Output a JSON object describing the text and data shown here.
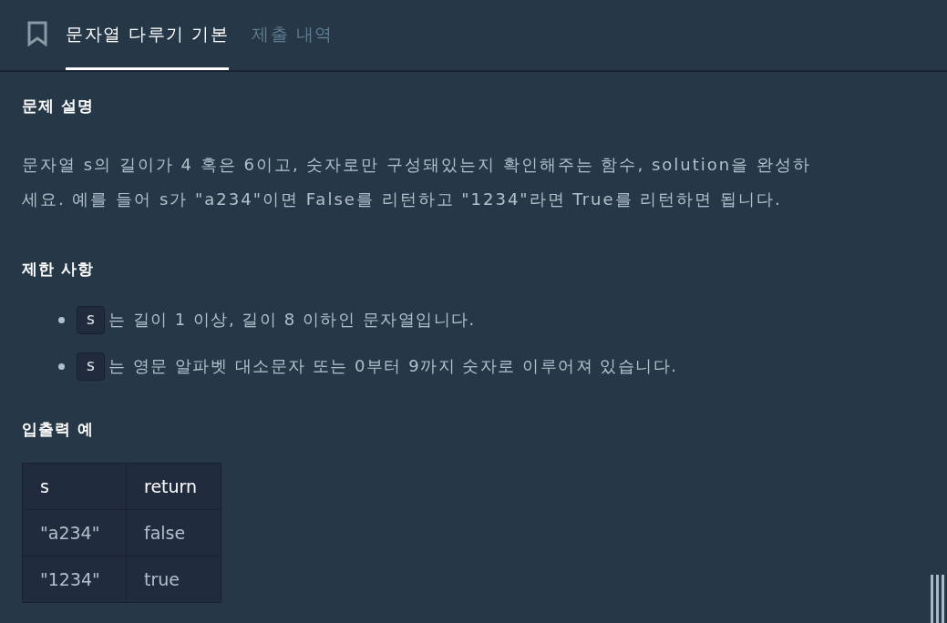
{
  "tabs": [
    {
      "label": "문자열 다루기 기본",
      "selected": true
    },
    {
      "label": "제출 내역",
      "selected": false
    }
  ],
  "description": {
    "title": "문제 설명",
    "text": "문자열 s의 길이가 4 혹은 6이고, 숫자로만 구성돼있는지 확인해주는 함수, solution을 완성하세요. 예를 들어 s가 \"a234\"이면 False를 리턴하고 \"1234\"라면 True를 리턴하면 됩니다."
  },
  "constraints": {
    "title": "제한 사항",
    "items": [
      {
        "code": "s",
        "text": "는 길이 1 이상, 길이 8 이하인 문자열입니다."
      },
      {
        "code": "s",
        "text": "는 영문 알파벳 대소문자 또는 0부터 9까지 숫자로 이루어져 있습니다."
      }
    ]
  },
  "examples": {
    "title": "입출력 예",
    "columns": [
      "s",
      "return"
    ],
    "rows": [
      [
        "\"a234\"",
        "false"
      ],
      [
        "\"1234\"",
        "true"
      ]
    ]
  }
}
